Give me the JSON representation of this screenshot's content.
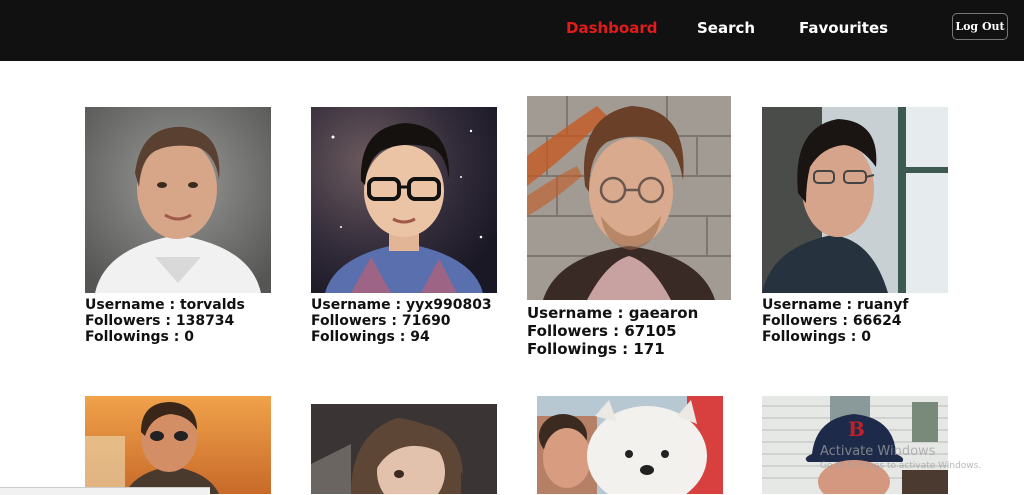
{
  "nav": {
    "dashboard": "Dashboard",
    "search": "Search",
    "favourites": "Favourites",
    "logout": "Log Out",
    "active_color": "#e21b1b"
  },
  "users": [
    {
      "username": "Username : torvalds",
      "followers": "Followers : 138734",
      "followings": "Followings : 0"
    },
    {
      "username": "Username : yyx990803",
      "followers": "Followers : 71690",
      "followings": "Followings : 94"
    },
    {
      "username": "Username : gaearon",
      "followers": "Followers : 67105",
      "followings": "Followings : 171"
    },
    {
      "username": "Username : ruanyf",
      "followers": "Followers : 66624",
      "followings": "Followings : 0"
    }
  ],
  "watermark": {
    "line1": "Activate Windows",
    "line2": "Go to Settings to activate Windows."
  }
}
